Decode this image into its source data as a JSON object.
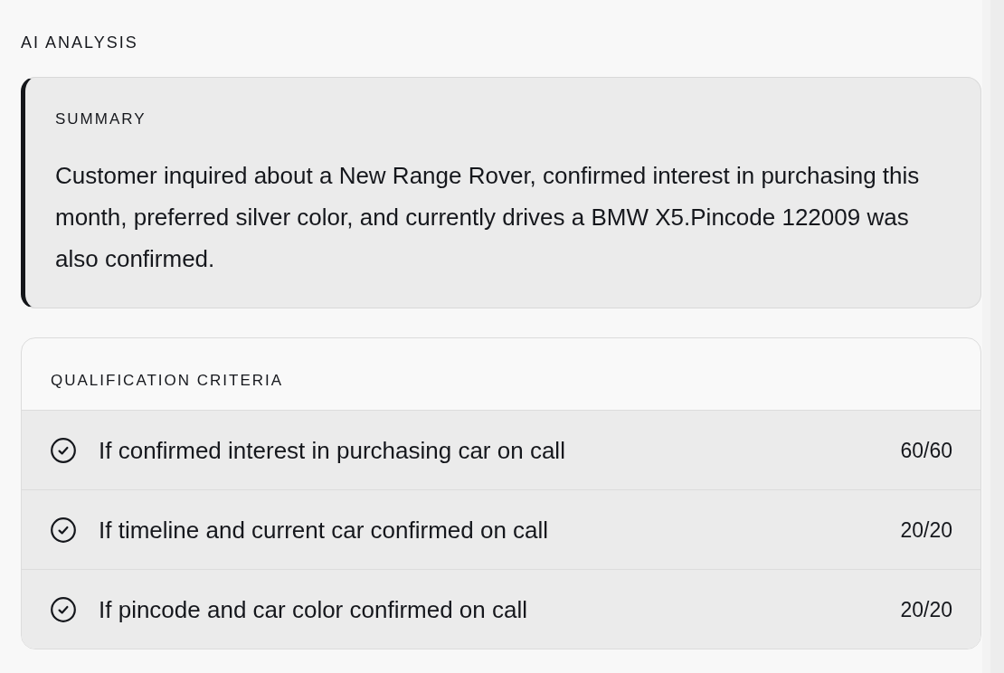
{
  "section_title": "AI ANALYSIS",
  "summary": {
    "label": "SUMMARY",
    "text": "Customer inquired about a New Range Rover, confirmed interest in purchasing this month, preferred silver color, and currently drives a BMW X5.Pincode 122009 was also confirmed."
  },
  "qualification": {
    "title": "QUALIFICATION CRITERIA",
    "criteria": [
      {
        "text": "If confirmed interest in purchasing car on call",
        "score": "60/60",
        "passed": true
      },
      {
        "text": "If timeline and current car confirmed on call",
        "score": "20/20",
        "passed": true
      },
      {
        "text": "If pincode and car color confirmed on call",
        "score": "20/20",
        "passed": true
      }
    ]
  }
}
